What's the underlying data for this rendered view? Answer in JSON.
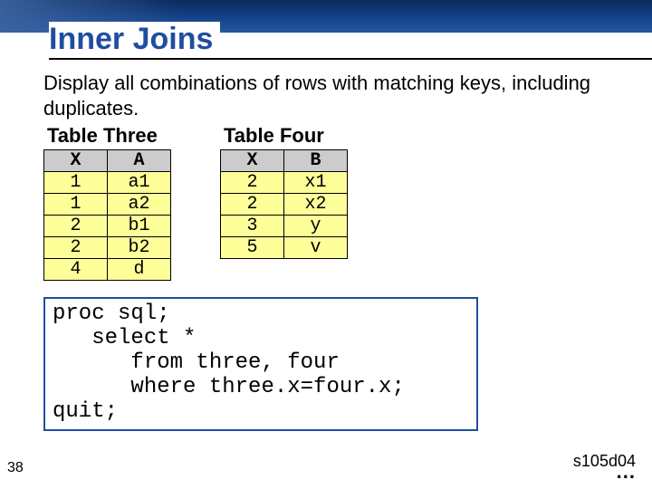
{
  "title": "Inner Joins",
  "description": "Display all combinations of rows with matching keys, including duplicates.",
  "table_three": {
    "label": "Table Three",
    "headers": [
      "X",
      "A"
    ],
    "rows": [
      [
        "1",
        "a1"
      ],
      [
        "1",
        "a2"
      ],
      [
        "2",
        "b1"
      ],
      [
        "2",
        "b2"
      ],
      [
        "4",
        "d"
      ]
    ]
  },
  "table_four": {
    "label": "Table Four",
    "headers": [
      "X",
      "B"
    ],
    "rows": [
      [
        "2",
        "x1"
      ],
      [
        "2",
        "x2"
      ],
      [
        "3",
        "y"
      ],
      [
        "5",
        "v"
      ]
    ]
  },
  "code": "proc sql;\n   select *\n      from three, four\n      where three.x=four.x;\nquit;",
  "slide_number": "38",
  "footer_code": "s105d04",
  "continuation": "..."
}
